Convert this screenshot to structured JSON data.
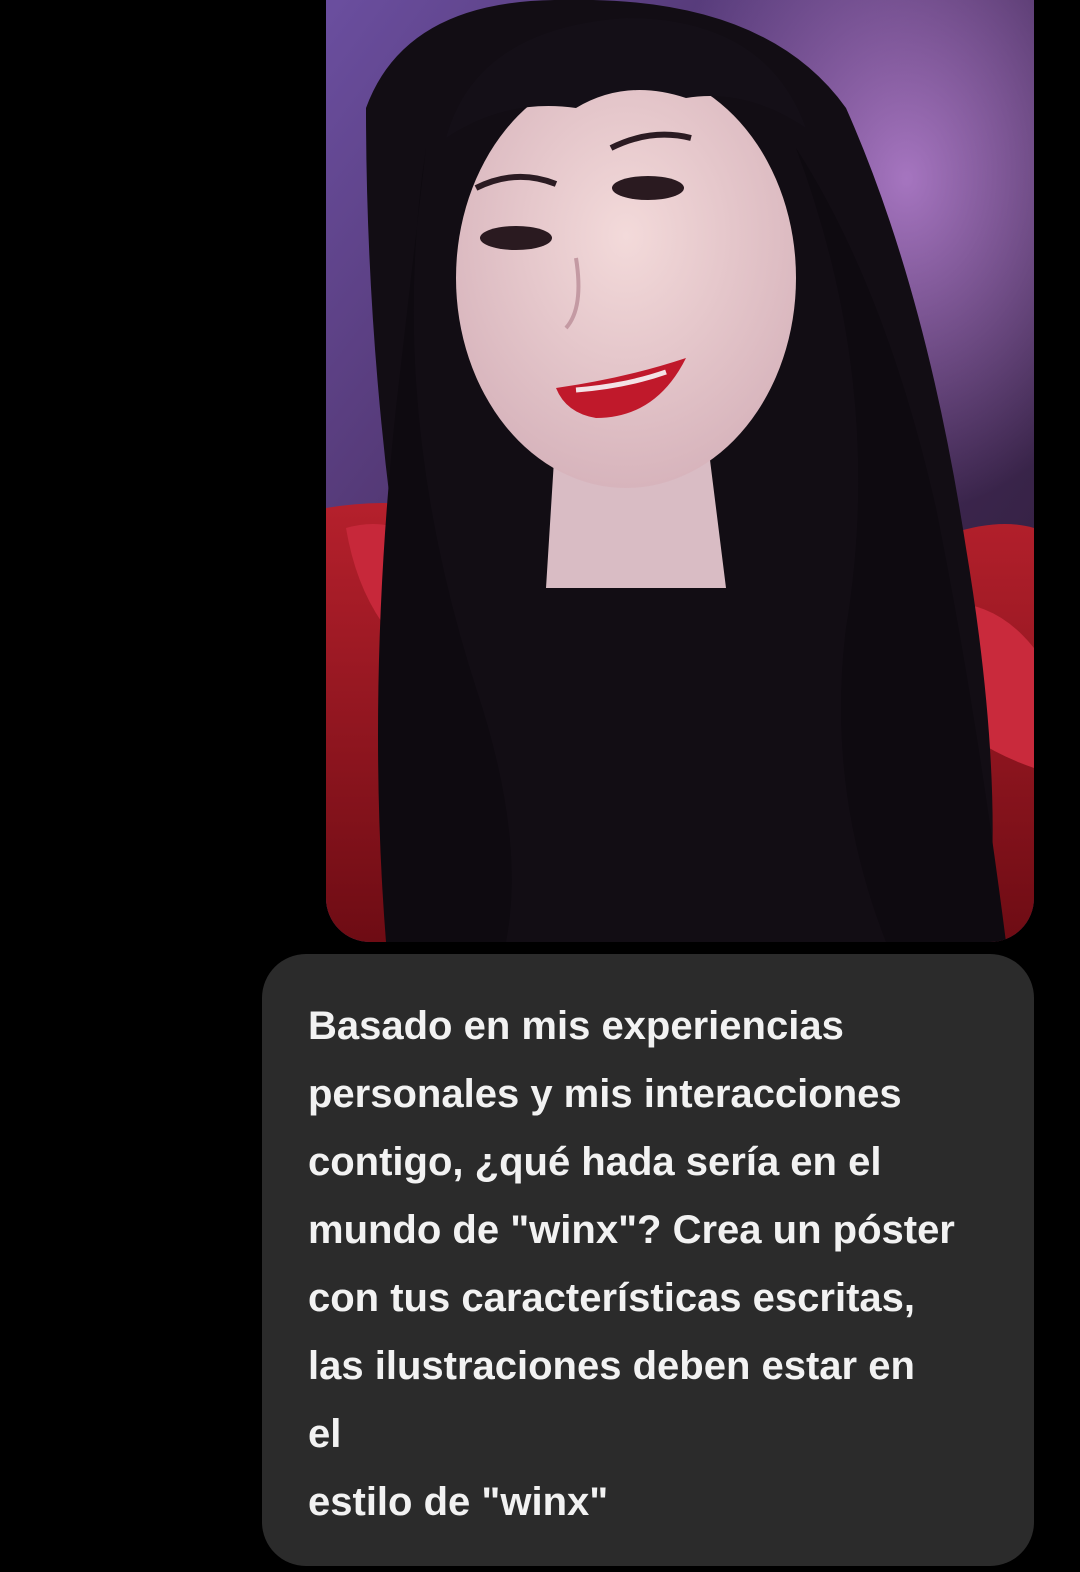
{
  "chat": {
    "photo_message": {
      "icon": "selfie-photo"
    },
    "text_message": {
      "text": "Basado en mis experiencias\npersonales y mis interacciones\ncontigo, ¿qué hada sería en el\nmundo de \"winx\"? Crea un póster\ncon tus características escritas,\nlas ilustraciones deben estar en\nel\nestilo de \"winx\""
    }
  },
  "colors": {
    "background": "#000000",
    "bubble": "#2b2b2b",
    "text": "#f2f2f2",
    "photo_backdrop": "#6a3f8e",
    "dress": "#9e1620"
  }
}
